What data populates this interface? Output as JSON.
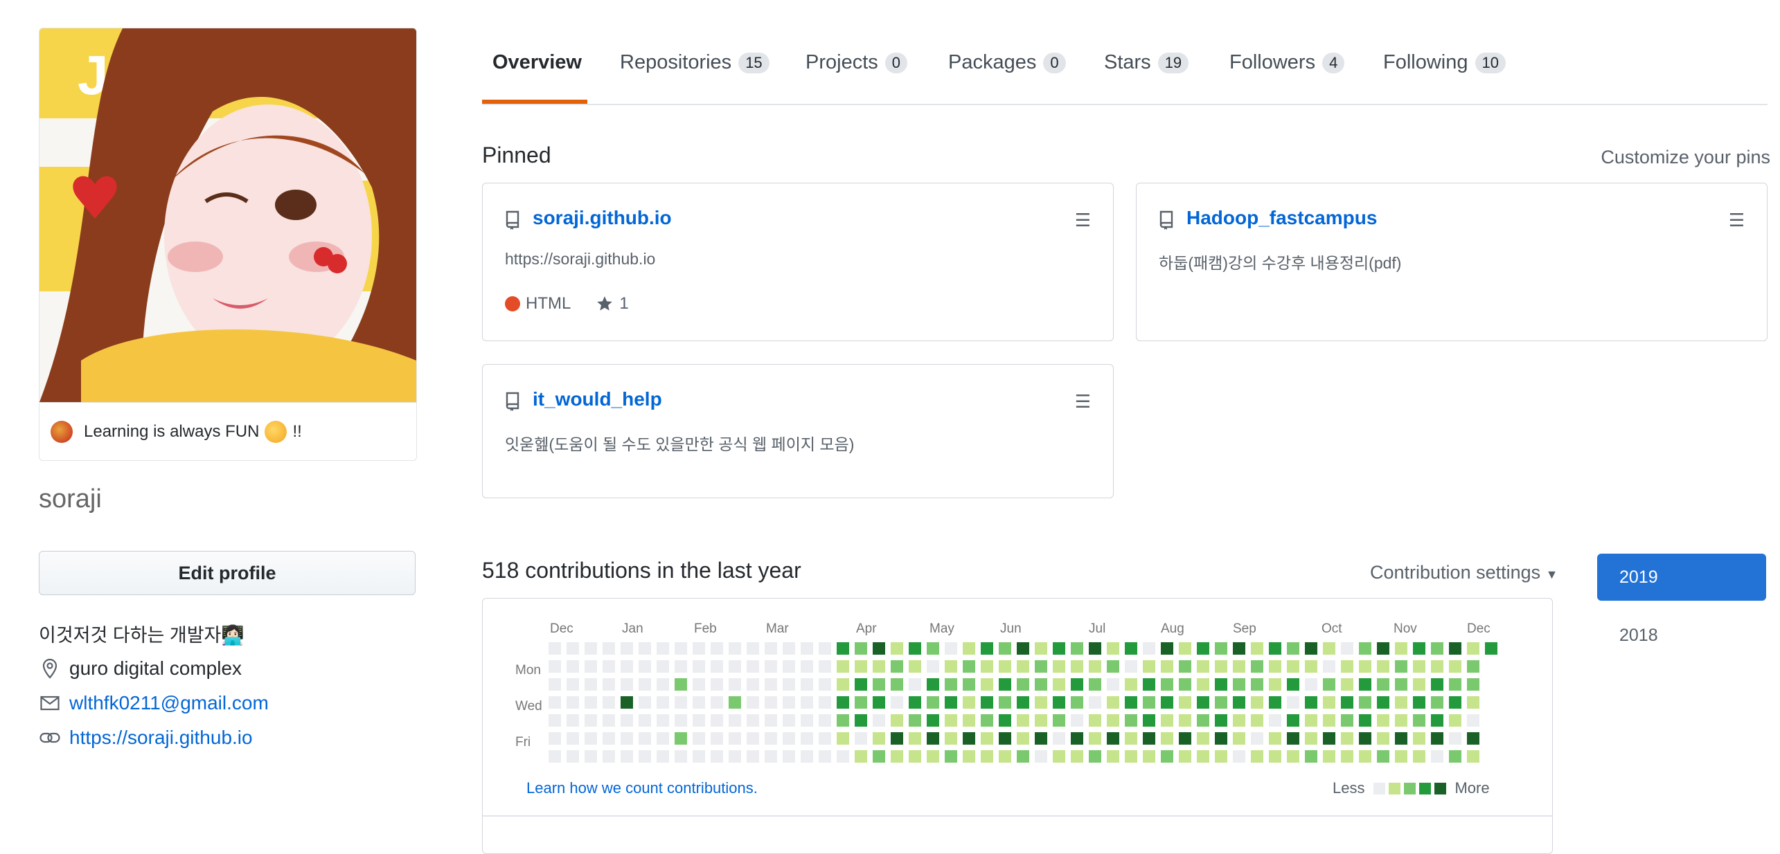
{
  "profile": {
    "status_text": "Learning is always FUN",
    "status_suffix": "!!",
    "username": "soraji",
    "edit_button": "Edit profile",
    "bio": "이것저것 다하는 개발자👩🏻‍💻",
    "location": "guro digital complex",
    "email": "wlthfk0211@gmail.com",
    "website": "https://soraji.github.io",
    "avatar_art_text": "JS"
  },
  "tabs": [
    {
      "label": "Overview"
    },
    {
      "label": "Repositories",
      "count": "15"
    },
    {
      "label": "Projects",
      "count": "0"
    },
    {
      "label": "Packages",
      "count": "0"
    },
    {
      "label": "Stars",
      "count": "19"
    },
    {
      "label": "Followers",
      "count": "4"
    },
    {
      "label": "Following",
      "count": "10"
    }
  ],
  "pinned": {
    "title": "Pinned",
    "customize": "Customize your pins",
    "cards": [
      {
        "name": "soraji.github.io",
        "desc": "https://soraji.github.io",
        "lang": "HTML",
        "lang_color": "#e34c26",
        "stars": "1"
      },
      {
        "name": "Hadoop_fastcampus",
        "desc": "하둡(패캠)강의 수강후 내용정리(pdf)"
      },
      {
        "name": "it_would_help",
        "desc": "잇욷헲(도움이 될 수도 있을만한 공식 웹 페이지 모음)"
      }
    ]
  },
  "contributions": {
    "title": "518 contributions in the last year",
    "settings": "Contribution settings",
    "months": [
      "Dec",
      "Jan",
      "Feb",
      "Mar",
      "Apr",
      "May",
      "Jun",
      "Jul",
      "Aug",
      "Sep",
      "Oct",
      "Nov",
      "Dec"
    ],
    "days": [
      "Mon",
      "Wed",
      "Fri"
    ],
    "learn": "Learn how we count contributions.",
    "less": "Less",
    "more": "More",
    "colors": [
      "#ebedf0",
      "#c6e48b",
      "#7bc96f",
      "#239a3b",
      "#196127"
    ],
    "pattern_seed": "3101200243102341201320432102"
  },
  "years": [
    "2019",
    "2018"
  ],
  "icons": {
    "repo": "repo-icon",
    "drag": "grabber-icon",
    "star": "star-icon",
    "location": "location-icon",
    "mail": "mail-icon",
    "link": "link-icon"
  }
}
